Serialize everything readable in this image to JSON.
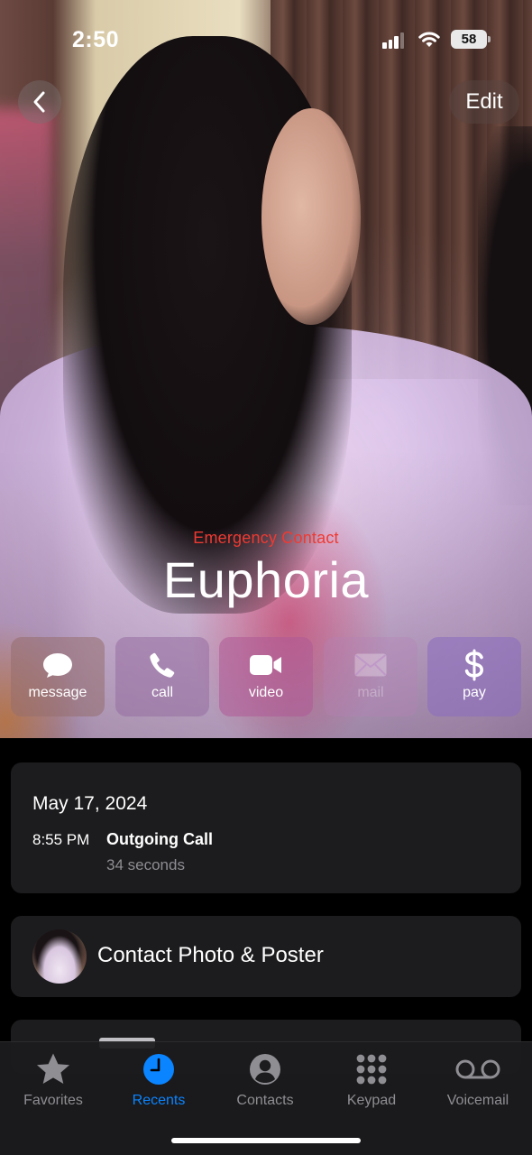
{
  "status_bar": {
    "time": "2:50",
    "battery": "58",
    "icons": [
      "cellular-signal-icon",
      "wifi-icon",
      "battery-icon"
    ]
  },
  "nav": {
    "back_icon": "chevron-left-icon",
    "edit_label": "Edit"
  },
  "contact": {
    "badge": "Emergency Contact",
    "name": "Euphoria"
  },
  "actions": [
    {
      "label": "message",
      "icon": "message-bubble-icon",
      "enabled": true
    },
    {
      "label": "call",
      "icon": "phone-icon",
      "enabled": true
    },
    {
      "label": "video",
      "icon": "video-camera-icon",
      "enabled": true
    },
    {
      "label": "mail",
      "icon": "envelope-icon",
      "enabled": false
    },
    {
      "label": "pay",
      "icon": "dollar-icon",
      "enabled": true
    }
  ],
  "recent_call": {
    "date": "May 17, 2024",
    "time": "8:55 PM",
    "type": "Outgoing Call",
    "duration": "34 seconds"
  },
  "poster": {
    "label": "Contact Photo & Poster"
  },
  "tabs": [
    {
      "label": "Favorites",
      "icon": "star-icon",
      "active": false
    },
    {
      "label": "Recents",
      "icon": "clock-icon",
      "active": true
    },
    {
      "label": "Contacts",
      "icon": "person-circle-icon",
      "active": false
    },
    {
      "label": "Keypad",
      "icon": "keypad-grid-icon",
      "active": false
    },
    {
      "label": "Voicemail",
      "icon": "voicemail-icon",
      "active": false
    }
  ],
  "colors": {
    "accent": "#0a84ff",
    "emergency": "#ee3a32",
    "card": "#1c1c1e",
    "secondary_text": "#8e8e93"
  }
}
